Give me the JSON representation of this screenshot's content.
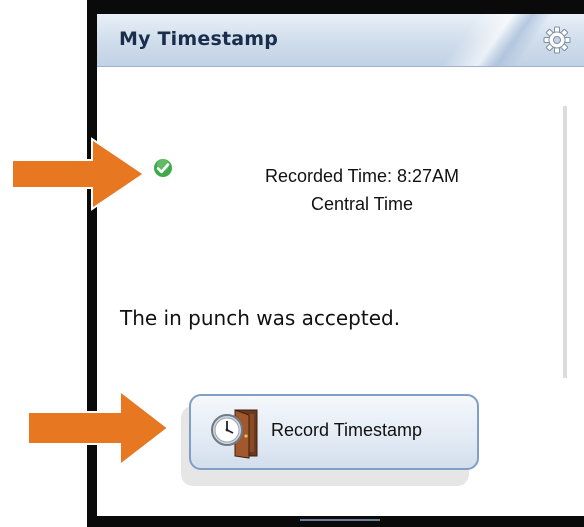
{
  "widget": {
    "title": "My Timestamp",
    "recorded_time_line": "Recorded Time: 8:27AM",
    "timezone_line": "Central Time",
    "message": "The in punch was accepted.",
    "record_button_label": "Record Timestamp",
    "settings_icon": "gear-icon",
    "status_icon": "check-circle-icon"
  },
  "annotations": {
    "arrow_color": "#e87722",
    "arrow_outline": "#ffffff"
  },
  "colors": {
    "header_text": "#1a2d4a",
    "status_green": "#3fa84a",
    "button_border": "#7f9fc4"
  }
}
